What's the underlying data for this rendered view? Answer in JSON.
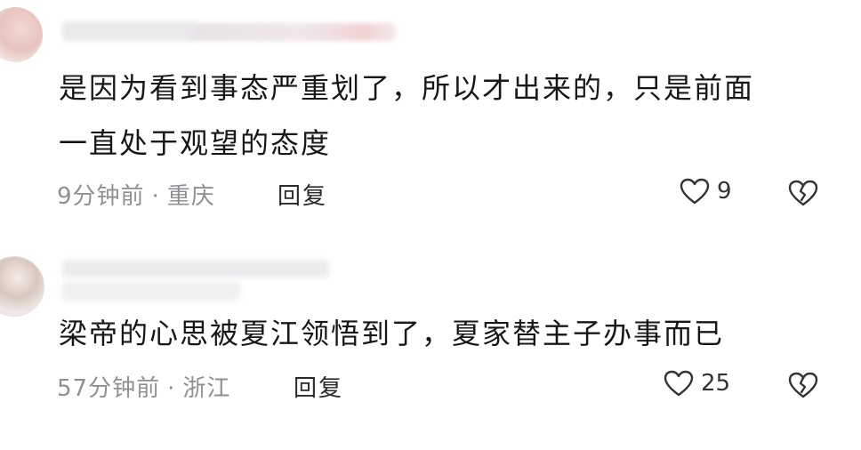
{
  "comments": [
    {
      "text_line1": "是因为看到事态严重划了，所以才出来的，只是前面",
      "text_line2": "一直处于观望的态度",
      "time": "9分钟前",
      "separator": "·",
      "location": "重庆",
      "reply_label": "回复",
      "like_count": "9",
      "like_icon": "heart-outline-icon",
      "dislike_icon": "broken-heart-icon"
    },
    {
      "text_line1": "梁帝的心思被夏江领悟到了，夏家替主子办事而已",
      "time": "57分钟前",
      "separator": "·",
      "location": "浙江",
      "reply_label": "回复",
      "like_count": "25",
      "like_icon": "heart-outline-icon",
      "dislike_icon": "broken-heart-icon"
    }
  ],
  "colors": {
    "text": "#171717",
    "meta": "#8f8f94",
    "icon": "#333333"
  }
}
